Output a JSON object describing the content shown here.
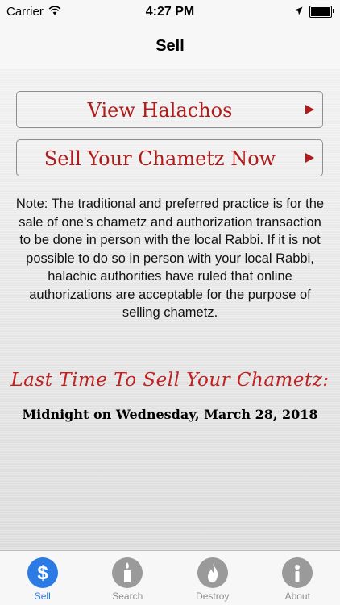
{
  "status_bar": {
    "carrier": "Carrier",
    "time": "4:27 PM",
    "battery_level": 1.0
  },
  "nav": {
    "title": "Sell"
  },
  "buttons": {
    "view_halachos": "View Halachos",
    "sell_chametz": "Sell Your Chametz Now"
  },
  "note": "Note: The traditional and preferred practice is for the sale of one's chametz and authorization transaction to be done in person with the local Rabbi. If it is not possible to do so in person with your local Rabbi, halachic authorities have ruled that online authorizations are acceptable for the purpose of selling chametz.",
  "deadline": {
    "label": "Last Time To Sell Your Chametz:",
    "date": "Midnight on Wednesday, March 28, 2018"
  },
  "tabs": [
    {
      "label": "Sell",
      "icon": "dollar-icon",
      "active": true
    },
    {
      "label": "Search",
      "icon": "candle-icon",
      "active": false
    },
    {
      "label": "Destroy",
      "icon": "flame-icon",
      "active": false
    },
    {
      "label": "About",
      "icon": "info-icon",
      "active": false
    }
  ],
  "colors": {
    "accent_red": "#b01b1b",
    "tab_active": "#2c7be5",
    "tab_inactive": "#8e8e8e"
  }
}
